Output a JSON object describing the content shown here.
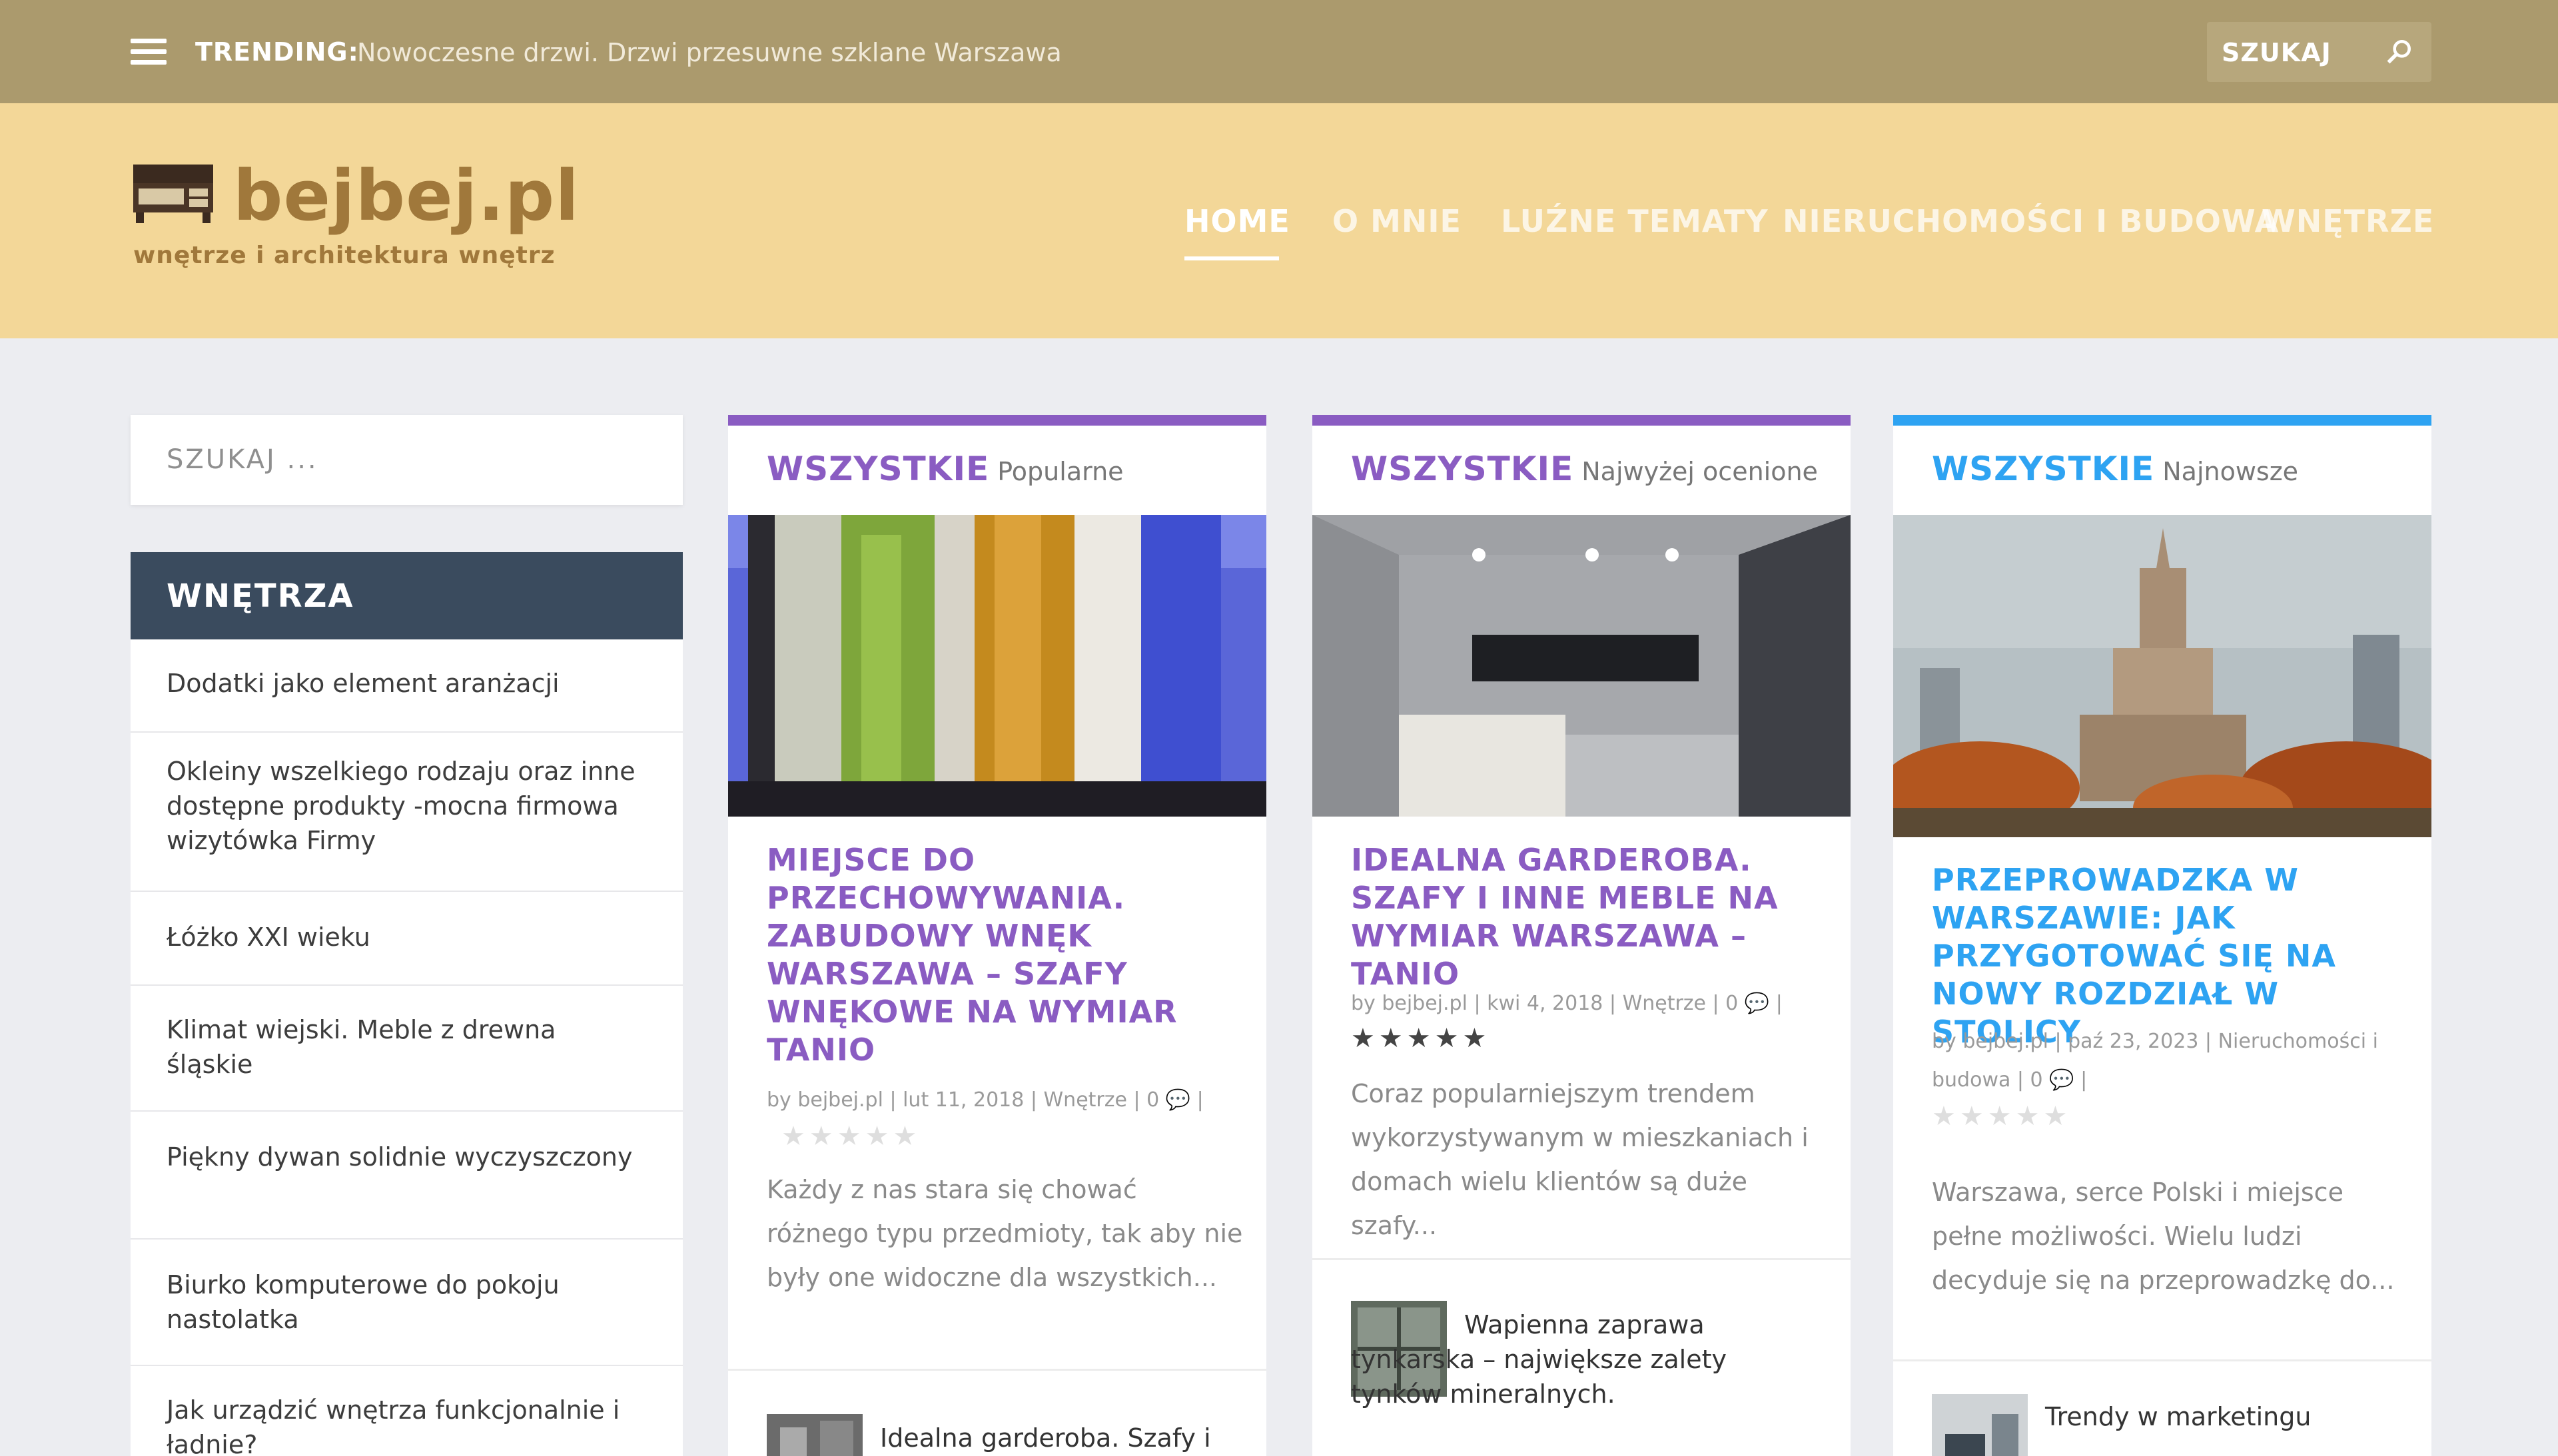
{
  "topbar": {
    "trending_label": "TRENDING:",
    "trending_text": "Nowoczesne drzwi. Drzwi przesuwne szklane Warszawa",
    "search_label": "SZUKAJ"
  },
  "header": {
    "logo_text": "bejbej.pl",
    "tagline": "wnętrze i architektura wnętrz",
    "nav": [
      "HOME",
      "O MNIE",
      "LUŹNE TEMATY",
      "NIERUCHOMOŚCI I BUDOWA",
      "WNĘTRZE"
    ]
  },
  "sidebar": {
    "search_placeholder": "SZUKAJ ...",
    "heading": "WNĘTRZA",
    "items": [
      "Dodatki jako element aranżacji",
      "Okleiny wszelkiego rodzaju oraz inne dostępne produkty -mocna firmowa wizytówka Firmy",
      "Łóżko XXI wieku",
      "Klimat wiejski. Meble z drewna śląskie",
      "Piękny dywan solidnie wyczyszczony",
      "Biurko komputerowe do pokoju nastolatka",
      "Jak urządzić wnętrza funkcjonalnie i ładnie?"
    ]
  },
  "cards": [
    {
      "category": "WSZYSTKIE",
      "tab": "Popularne",
      "accent": "#8a5cc2",
      "title": "MIEJSCE DO PRZECHOWYWANIA. ZABUDOWY WNĘK WARSZAWA – SZAFY WNĘKOWE NA WYMIAR TANIO",
      "meta": "by bejbej.pl | lut 11, 2018 | Wnętrze | 0 💬 |",
      "stars": "★★★★★",
      "excerpt": "Każdy z nas stara się chować różnego typu przedmioty, tak aby nie były one widoczne dla wszystkich...",
      "related": "Idealna garderoba. Szafy i"
    },
    {
      "category": "WSZYSTKIE",
      "tab": "Najwyżej ocenione",
      "accent": "#8a5cc2",
      "title": "IDEALNA GARDEROBA. SZAFY I INNE MEBLE NA WYMIAR WARSZAWA – TANIO",
      "meta": "by bejbej.pl | kwi 4, 2018 | Wnętrze | 0 💬 |",
      "stars": "★★★★★",
      "excerpt": "Coraz popularniejszym trendem wykorzystywanym w mieszkaniach i domach wielu klientów są duże szafy...",
      "related": "Wapienna zaprawa tynkarska – największe zalety tynków mineralnych."
    },
    {
      "category": "WSZYSTKIE",
      "tab": "Najnowsze",
      "accent": "#2ea3f2",
      "title": "PRZEPROWADZKA W WARSZAWIE: JAK PRZYGOTOWAĆ SIĘ NA NOWY ROZDZIAŁ W STOLICY",
      "meta": "by bejbej.pl | paź 23, 2023 | Nieruchomości i budowa | 0 💬 |",
      "stars": "★★★★★",
      "excerpt": "Warszawa, serce Polski i miejsce pełne możliwości. Wielu ludzi decyduje się na przeprowadzkę do...",
      "related": "Trendy w marketingu"
    }
  ],
  "colors": {
    "topbar": "#ab9a6d",
    "header": "#f3d798",
    "logo": "#a0783b",
    "sidebar_heading": "#3a4b5e",
    "purple": "#8a5cc2",
    "blue": "#2ea3f2"
  }
}
